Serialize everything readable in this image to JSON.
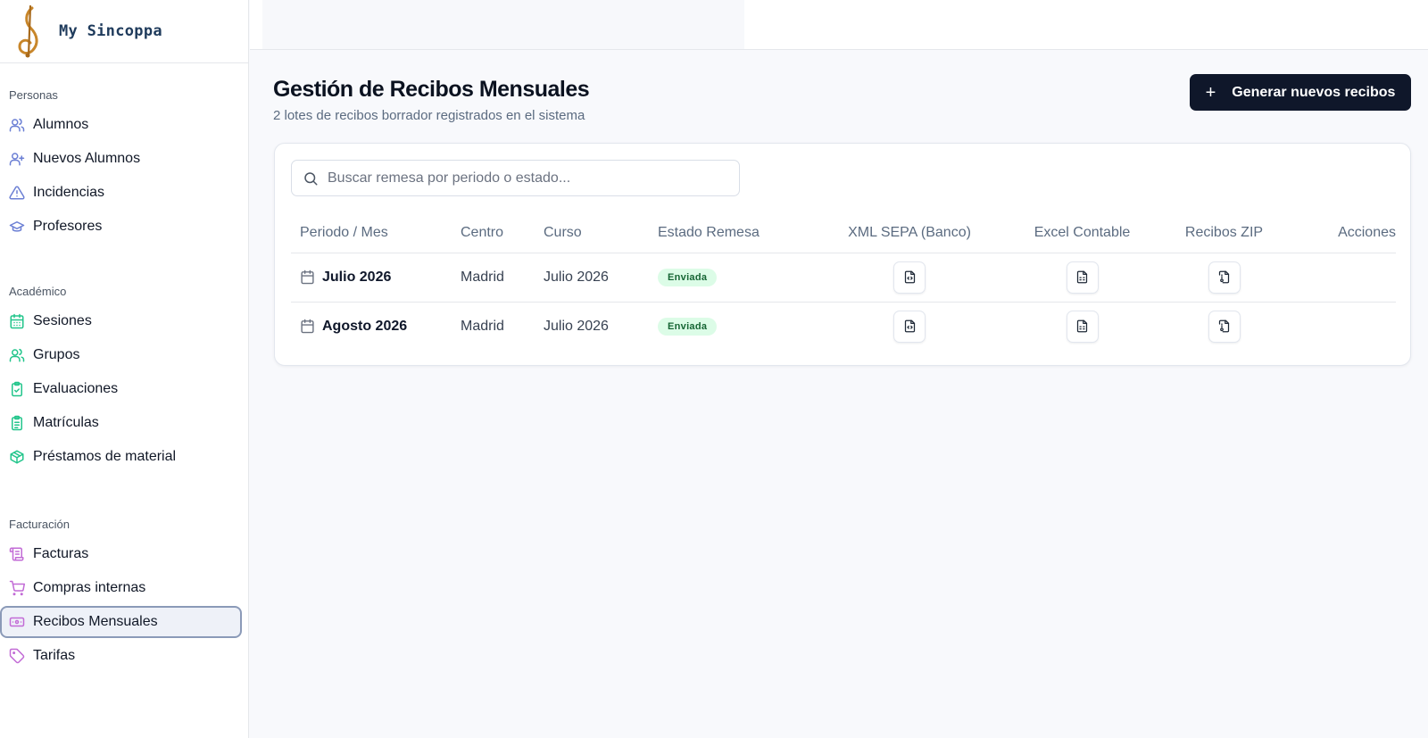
{
  "brand": {
    "name": "My Sincoppa"
  },
  "sidebar": {
    "sections": [
      {
        "title": "Personas",
        "items": [
          {
            "label": "Alumnos",
            "icon": "users-icon",
            "color": "#6b7fd4"
          },
          {
            "label": "Nuevos Alumnos",
            "icon": "user-plus-icon",
            "color": "#6b7fd4"
          },
          {
            "label": "Incidencias",
            "icon": "alert-triangle-icon",
            "color": "#6b7fd4"
          },
          {
            "label": "Profesores",
            "icon": "graduation-cap-icon",
            "color": "#6b7fd4"
          }
        ]
      },
      {
        "title": "Académico",
        "items": [
          {
            "label": "Sesiones",
            "icon": "calendar-grid-icon",
            "color": "#22c58b"
          },
          {
            "label": "Grupos",
            "icon": "users-icon",
            "color": "#22c58b"
          },
          {
            "label": "Evaluaciones",
            "icon": "clipboard-check-icon",
            "color": "#22c58b"
          },
          {
            "label": "Matrículas",
            "icon": "clipboard-list-icon",
            "color": "#22c58b"
          },
          {
            "label": "Préstamos de material",
            "icon": "package-icon",
            "color": "#22c58b"
          }
        ]
      },
      {
        "title": "Facturación",
        "items": [
          {
            "label": "Facturas",
            "icon": "receipt-scroll-icon",
            "color": "#c26bd6"
          },
          {
            "label": "Compras internas",
            "icon": "shopping-cart-icon",
            "color": "#c26bd6"
          },
          {
            "label": "Recibos Mensuales",
            "icon": "banknote-icon",
            "color": "#c26bd6",
            "active": true
          },
          {
            "label": "Tarifas",
            "icon": "tag-icon",
            "color": "#c26bd6"
          }
        ]
      }
    ]
  },
  "main": {
    "title": "Gestión de Recibos Mensuales",
    "subtitle": "2 lotes de recibos borrador registrados en el sistema",
    "primary_button": "Generar nuevos recibos",
    "search_placeholder": "Buscar remesa por periodo o estado...",
    "columns": [
      "Periodo / Mes",
      "Centro",
      "Curso",
      "Estado Remesa",
      "XML SEPA (Banco)",
      "Excel Contable",
      "Recibos ZIP",
      "Acciones"
    ],
    "rows": [
      {
        "periodo": "Julio 2026",
        "centro": "Madrid",
        "curso": "Julio 2026",
        "estado": "Enviada"
      },
      {
        "periodo": "Agosto 2026",
        "centro": "Madrid",
        "curso": "Julio 2026",
        "estado": "Enviada"
      }
    ]
  },
  "colors": {
    "accent_dark": "#0f172a",
    "badge_bg": "#dcfce7",
    "badge_text": "#166534"
  }
}
